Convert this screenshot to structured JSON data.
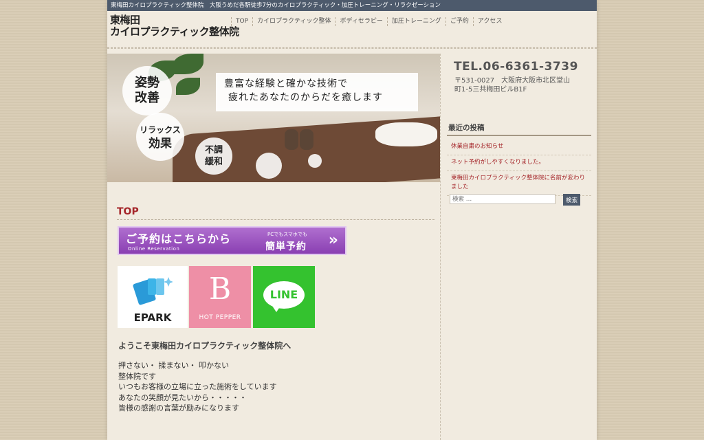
{
  "topbar": {
    "text": "東梅田カイロプラクティック整体院　大阪うめだ各駅徒歩7分のカイロプラクティック・加圧トレーニング・リラクゼーション"
  },
  "site": {
    "logo_line1": "東梅田",
    "logo_line2": "カイロプラクティック整体院"
  },
  "nav": [
    {
      "label": "TOP"
    },
    {
      "label": "カイロプラクティック整体"
    },
    {
      "label": "ボディセラピー"
    },
    {
      "label": "加圧トレーニング"
    },
    {
      "label": "ご予約"
    },
    {
      "label": "アクセス"
    }
  ],
  "hero": {
    "circle1_line1": "姿勢",
    "circle1_line2": "改善",
    "circle2_line1": "リラックス",
    "circle2_line2": "効果",
    "circle3_line1": "不調",
    "circle3_line2": "緩和",
    "tag_line1": "豊富な経験と確かな技術で",
    "tag_line2": "疲れたあなたのからだを癒します"
  },
  "main": {
    "heading": "TOP",
    "reserve": {
      "title": "ご予約はこちらから",
      "subtitle": "Online Reservation",
      "note": "PCでもスマホでも",
      "easy": "簡単予約",
      "chevron": "»"
    },
    "banners": {
      "epark": "EPARK",
      "hotpepper_letter": "B",
      "hotpepper": "HOT PEPPER",
      "line": "LINE"
    },
    "welcome": "ようこそ東梅田カイロプラクティック整体院へ",
    "body_lines": [
      "押さない・ 揉まない・ 叩かない",
      "整体院です",
      "いつもお客様の立場に立った施術をしています",
      "あなたの笑顔が見たいから・・・・・",
      "皆様の感謝の言葉が励みになります"
    ]
  },
  "sidebar": {
    "tel": "TEL.06-6361-3739",
    "address_line1": "〒531-0027　大阪府大阪市北区堂山",
    "address_line2": "町1-5三共梅田ビルB1F",
    "recent_title": "最近の投稿",
    "posts": [
      {
        "title": "休業自粛のお知らせ"
      },
      {
        "title": "ネット予約がしやすくなりました。"
      },
      {
        "title": "東梅田カイロプラクティック整体院に名前が変わりました"
      }
    ],
    "search_placeholder": "検索 …",
    "search_button": "検索"
  },
  "colors": {
    "topbar_bg": "#4d5a6c",
    "heading_red": "#a5262a",
    "reserve_purple": "#8a3fb2",
    "hotpepper_pink": "#ee8fa6",
    "line_green": "#34c22f"
  }
}
